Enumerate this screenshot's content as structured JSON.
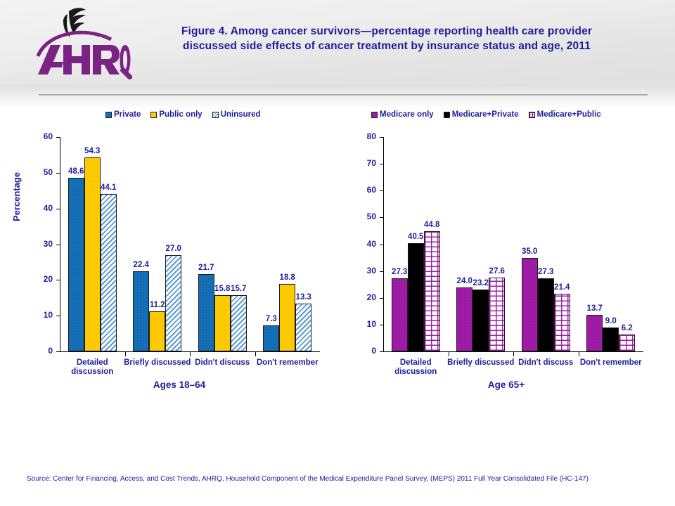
{
  "header": {
    "logo_alt": "AHRQ Agency for Healthcare Research and Quality",
    "title": "Figure 4. Among cancer survivors—percentage reporting health care provider discussed side effects of cancer treatment by insurance status and age, 2011"
  },
  "source": "Source: Center for Financing, Access, and Cost Trends, AHRQ, Household Component of the Medical Expenditure Panel Survey,  (MEPS) 2011 Full Year Consolidated File (HC-147)",
  "colors": {
    "private": "#1570b8",
    "public_only": "#ffcc00",
    "uninsured": "#ffffff",
    "medicare_only": "#a01ca8",
    "medicare_private": "#000000",
    "medicare_public": "#ffffff",
    "text": "#1d1d9b"
  },
  "chart_data": [
    {
      "type": "bar",
      "title": "Ages 18–64",
      "categories": [
        "Detailed discussion",
        "Briefly discussed",
        "Didn't discuss",
        "Don't remember"
      ],
      "series": [
        {
          "name": "Private",
          "values": [
            48.6,
            22.4,
            21.7,
            7.3
          ]
        },
        {
          "name": "Public only",
          "values": [
            54.3,
            11.2,
            15.8,
            18.8
          ]
        },
        {
          "name": "Uninsured",
          "values": [
            44.1,
            27.0,
            15.7,
            13.3
          ]
        }
      ],
      "xlabel": "Ages 18–64",
      "ylabel": "Percentage",
      "ylim": [
        0,
        60
      ],
      "yticks": [
        0,
        10,
        20,
        30,
        40,
        50,
        60
      ],
      "grid": false,
      "legend_position": "top"
    },
    {
      "type": "bar",
      "title": "Age 65+",
      "categories": [
        "Detailed discussion",
        "Briefly discussed",
        "Didn't discuss",
        "Don't remember"
      ],
      "series": [
        {
          "name": "Medicare only",
          "values": [
            27.3,
            24.0,
            35.0,
            13.7
          ]
        },
        {
          "name": "Medicare+Private",
          "values": [
            40.5,
            23.2,
            27.3,
            9.0
          ]
        },
        {
          "name": "Medicare+Public",
          "values": [
            44.8,
            27.6,
            21.4,
            6.2
          ]
        }
      ],
      "xlabel": "Age 65+",
      "ylabel": "",
      "ylim": [
        0,
        80
      ],
      "yticks": [
        0,
        10,
        20,
        30,
        40,
        50,
        60,
        70,
        80
      ],
      "grid": false,
      "legend_position": "top"
    }
  ]
}
